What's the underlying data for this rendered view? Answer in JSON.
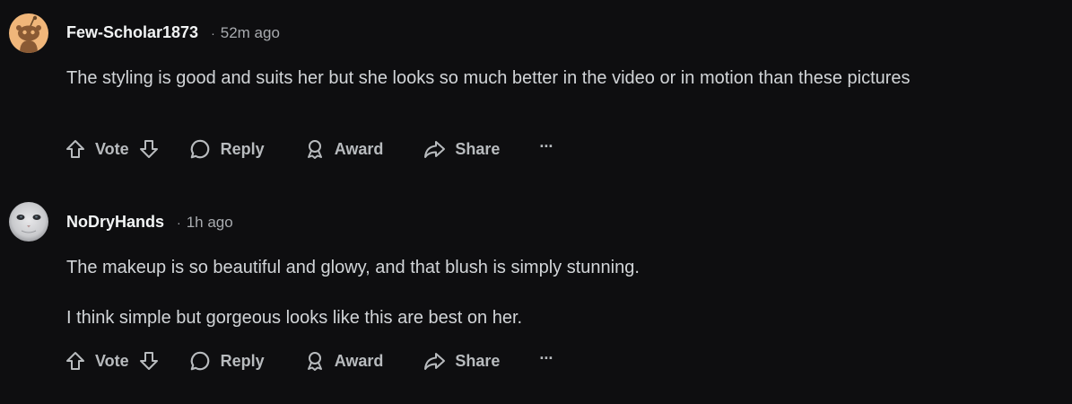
{
  "comments": [
    {
      "username": "Few-Scholar1873",
      "separator": "·",
      "time": "52m ago",
      "paragraphs": [
        "The styling is good and suits her but she looks so much better in the video or in motion than these pictures"
      ],
      "avatar_icon": "snoo-avatar-icon",
      "actions": {
        "vote": "Vote",
        "reply": "Reply",
        "award": "Award",
        "share": "Share",
        "more": "···"
      }
    },
    {
      "username": "NoDryHands",
      "separator": "·",
      "time": "1h ago",
      "paragraphs": [
        "The makeup is so beautiful and glowy, and that blush is simply stunning.",
        "I think simple but gorgeous looks like this are best on her."
      ],
      "avatar_icon": "cat-photo-avatar",
      "actions": {
        "vote": "Vote",
        "reply": "Reply",
        "award": "Award",
        "share": "Share",
        "more": "···"
      }
    }
  ],
  "colors": {
    "background": "#0e0e10",
    "text": "#d2d5d8",
    "muted": "#a8abaf",
    "avatar_bg": "#f0b67a"
  }
}
